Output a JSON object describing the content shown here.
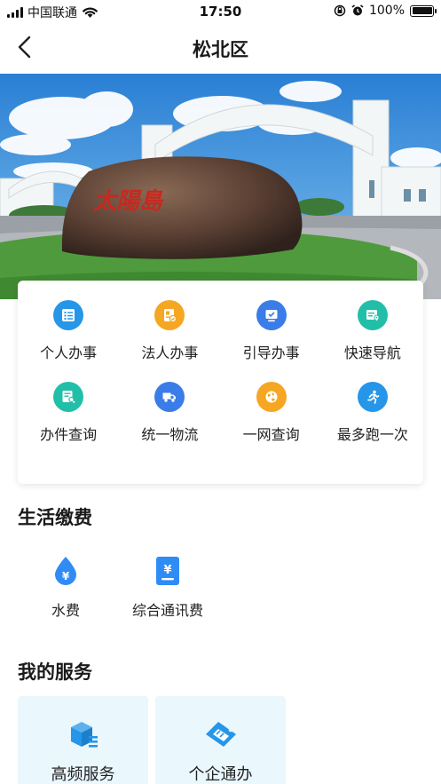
{
  "status_bar": {
    "carrier": "中国联通",
    "time": "17:50",
    "battery": "100%",
    "battery_level": 1.0,
    "icons": [
      "signal-icon",
      "wifi-icon",
      "orientation-lock-icon",
      "alarm-icon",
      "battery-icon"
    ]
  },
  "nav": {
    "title": "松北区",
    "back_icon": "chevron-left-icon"
  },
  "banner": {
    "slides": 1,
    "active_index": 0,
    "rock_inscription": "太陽島"
  },
  "services": [
    {
      "label": "个人办事",
      "icon": "person-list-icon",
      "color": "#2596e8"
    },
    {
      "label": "法人办事",
      "icon": "corporate-doc-icon",
      "color": "#f5a623"
    },
    {
      "label": "引导办事",
      "icon": "guide-screen-icon",
      "color": "#3a7de8"
    },
    {
      "label": "快速导航",
      "icon": "navigation-card-icon",
      "color": "#22bfa8"
    },
    {
      "label": "办件查询",
      "icon": "case-query-icon",
      "color": "#22bfa8"
    },
    {
      "label": "统一物流",
      "icon": "logistics-truck-icon",
      "color": "#3a7de8"
    },
    {
      "label": "一网查询",
      "icon": "globe-icon",
      "color": "#f5a623"
    },
    {
      "label": "最多跑一次",
      "icon": "running-person-icon",
      "color": "#2596e8"
    }
  ],
  "life_payment": {
    "title": "生活缴费",
    "items": [
      {
        "label": "水费",
        "icon": "water-drop-yuan-icon",
        "color": "#2f8cf5"
      },
      {
        "label": "综合通讯费",
        "icon": "phone-bill-yuan-icon",
        "color": "#2f8cf5"
      }
    ]
  },
  "my_services": {
    "title": "我的服务",
    "items": [
      {
        "label": "高频服务",
        "icon": "cube-stack-icon",
        "color": "#2596e8"
      },
      {
        "label": "个企通办",
        "icon": "ticket-icon",
        "color": "#2596e8"
      }
    ]
  }
}
